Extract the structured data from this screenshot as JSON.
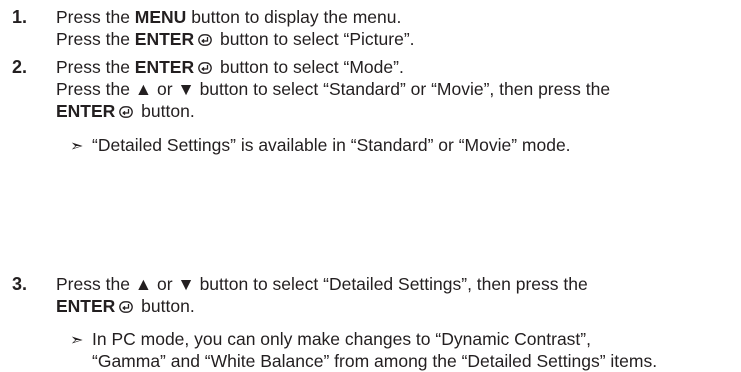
{
  "steps": [
    {
      "number": "1.",
      "lines": [
        {
          "pre": "Press the ",
          "bold": "MENU",
          "post": " button to display the menu."
        },
        {
          "pre": "Press the ",
          "bold": "ENTER",
          "post": " button to select “Picture”."
        }
      ]
    },
    {
      "number": "2.",
      "lines": [
        {
          "pre": "Press the ",
          "bold": "ENTER",
          "post": " button to select “Mode”."
        },
        {
          "text": "Press the ▲ or ▼ button to select “Standard” or “Movie”, then press the"
        },
        {
          "bold": "ENTER",
          "post": " button."
        }
      ],
      "note": "“Detailed Settings” is available in “Standard” or “Movie” mode."
    },
    {
      "number": "3.",
      "lines": [
        {
          "text": "Press the ▲ or ▼ button to select “Detailed Settings”, then press the"
        },
        {
          "bold": "ENTER",
          "post": " button."
        }
      ],
      "note": "In PC mode, you can only make changes to “Dynamic Contrast”,",
      "note_cont": "“Gamma” and “White Balance” from among the “Detailed Settings” items."
    }
  ],
  "note_marker": "➣"
}
